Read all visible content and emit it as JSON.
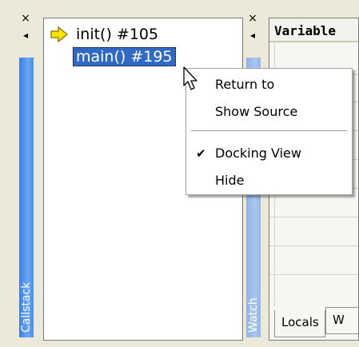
{
  "callstack_strip": {
    "close_glyph": "×",
    "arrow_glyph": "◂",
    "label": "Callstack"
  },
  "watch_strip": {
    "close_glyph": "×",
    "arrow_glyph": "◂",
    "label": "Watch"
  },
  "callstack": {
    "frames": [
      {
        "label": "init() #105",
        "current": true,
        "selected": false
      },
      {
        "label": "main() #195",
        "current": false,
        "selected": true
      }
    ]
  },
  "variables": {
    "header": "Variable",
    "tabs": [
      "Locals",
      "W"
    ]
  },
  "context_menu": {
    "items": [
      {
        "label": "Return to",
        "checked": false
      },
      {
        "label": "Show Source",
        "checked": false
      },
      {
        "label": "Docking View",
        "checked": true
      },
      {
        "label": "Hide",
        "checked": false
      }
    ]
  },
  "icons": {
    "current_frame": "yellow-right-arrow-icon",
    "cursor": "mouse-pointer-icon",
    "check": "checkmark-icon"
  },
  "colors": {
    "selection": "#316ac5",
    "callstack_bar": "#4d8ee8",
    "watch_bar": "#a9c6f0",
    "arrow": "#ffe600"
  }
}
